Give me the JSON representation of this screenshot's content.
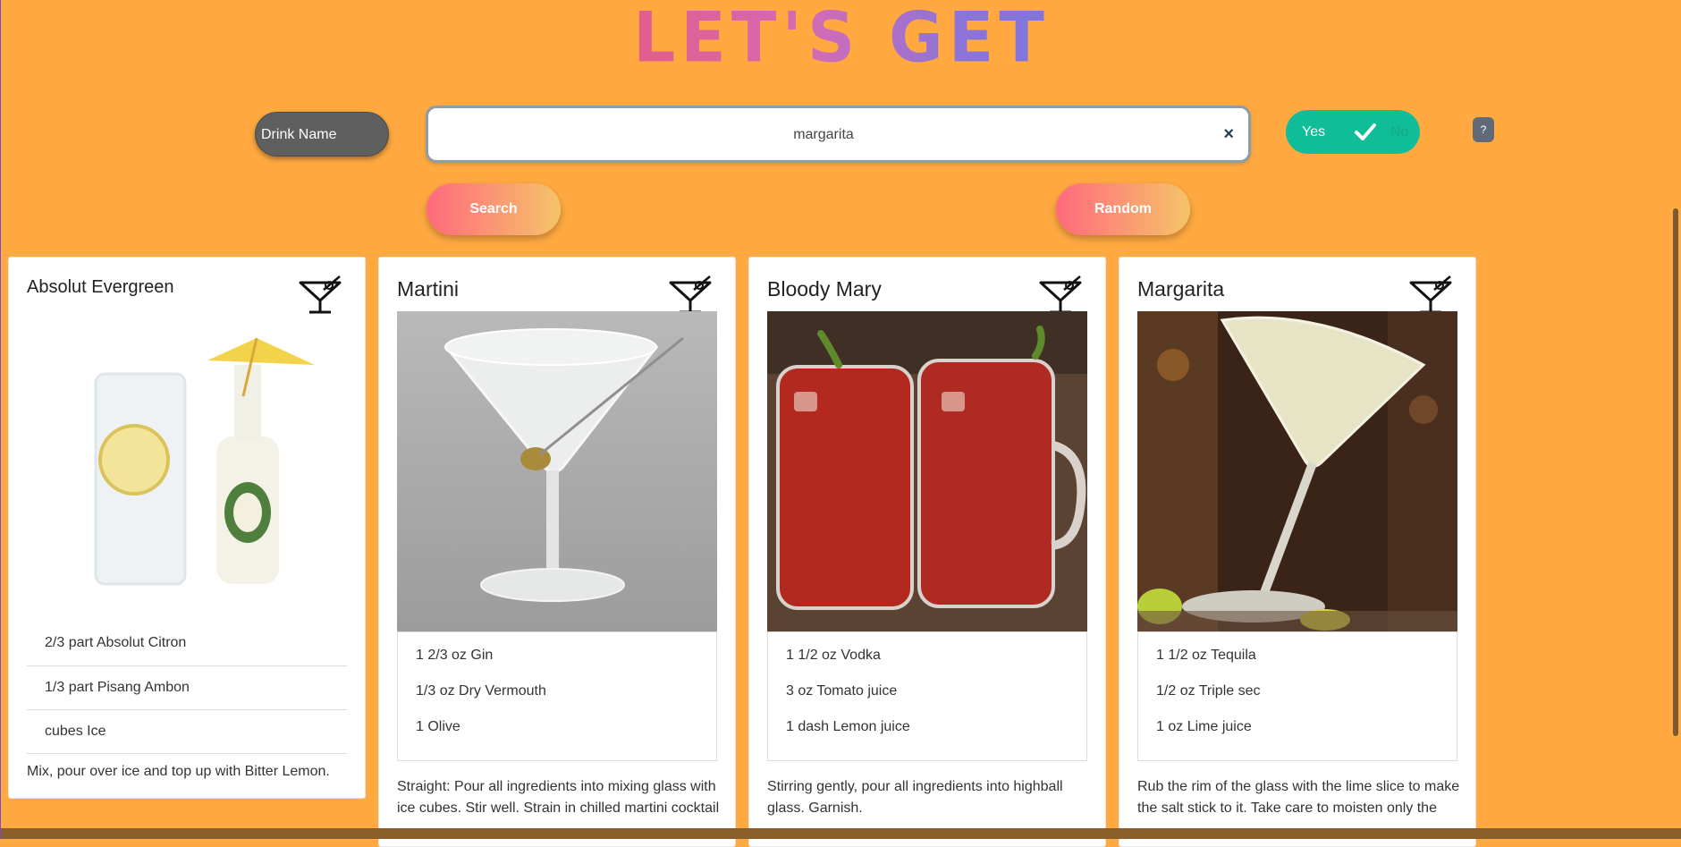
{
  "header": {
    "title": "LET'S GET DRUNK!"
  },
  "controls": {
    "mode_label": "Drink Name",
    "search_value": "margarita",
    "clear_symbol": "×",
    "toggle_yes": "Yes",
    "toggle_no": "No",
    "help_label": "?",
    "search_label": "Search",
    "random_label": "Random"
  },
  "cards": [
    {
      "name": "Absolut Evergreen",
      "ingredients": [
        "2/3 part Absolut Citron",
        "1/3 part Pisang Ambon",
        "cubes Ice"
      ],
      "instructions": "Mix, pour over ice and top up with Bitter Lemon."
    },
    {
      "name": "Martini",
      "ingredients": [
        "1 2/3 oz Gin",
        "1/3 oz Dry Vermouth",
        "1 Olive"
      ],
      "instructions": "Straight: Pour all ingredients into mixing glass with ice cubes. Stir well. Strain in chilled martini cocktail glass. Squeeze oil from lemon peel onto the drink"
    },
    {
      "name": "Bloody Mary",
      "ingredients": [
        "1 1/2 oz Vodka",
        "3 oz Tomato juice",
        "1 dash Lemon juice"
      ],
      "instructions": "Stirring gently, pour all ingredients into highball glass. Garnish."
    },
    {
      "name": "Margarita",
      "ingredients": [
        "1 1/2 oz Tequila",
        "1/2 oz Triple sec",
        "1 oz Lime juice"
      ],
      "instructions": "Rub the rim of the glass with the lime slice to make the salt stick to it. Take care to moisten only the outer rim and sprinkle the salt on it. The salt"
    }
  ],
  "colors": {
    "background": "#ffa940",
    "toggle": "#0fbe98",
    "mode_button": "#5f5f5f"
  },
  "icons": [
    "cocktail-glass-icon",
    "check-icon",
    "close-icon"
  ]
}
